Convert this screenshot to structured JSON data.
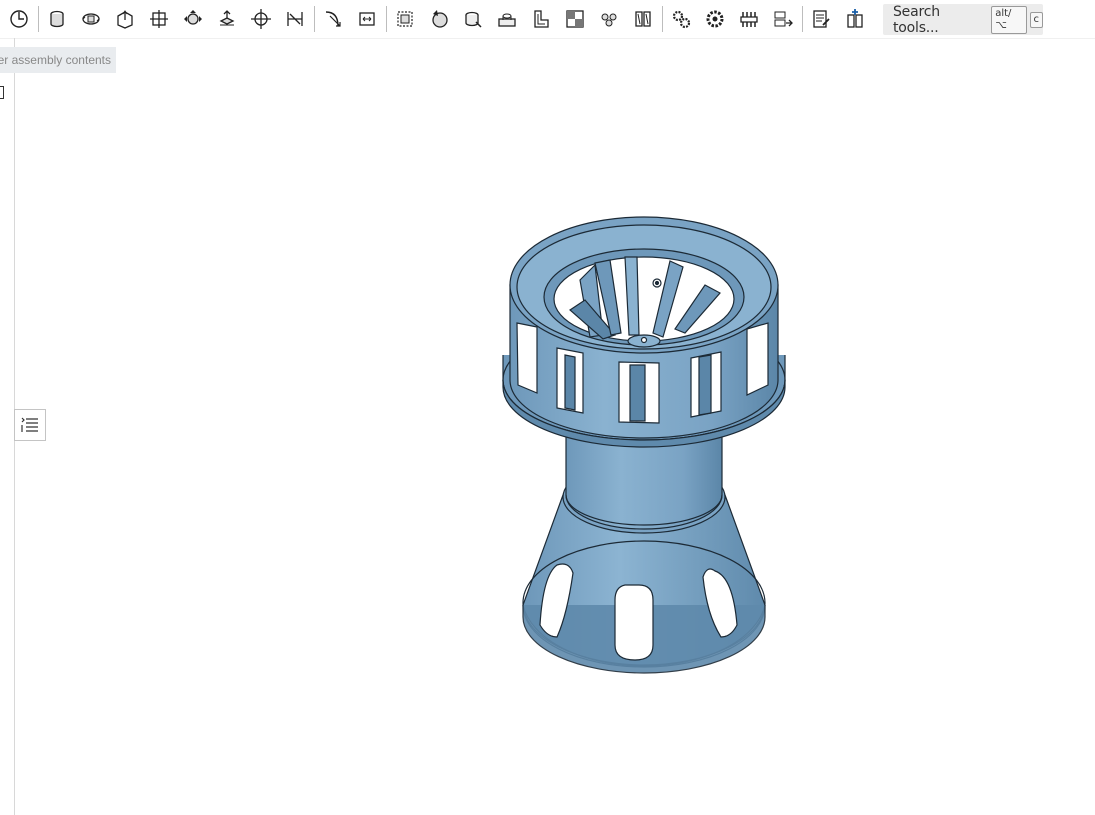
{
  "toolbar": {
    "tools": [
      {
        "name": "history-icon"
      },
      {
        "name": "extrude-icon"
      },
      {
        "name": "revolve-icon"
      },
      {
        "name": "sweep-icon"
      },
      {
        "name": "loft-icon"
      },
      {
        "name": "thicken-icon"
      },
      {
        "name": "enclose-icon"
      },
      {
        "name": "transform-icon"
      },
      {
        "name": "mirror-icon"
      },
      {
        "name": "fillet-icon"
      },
      {
        "name": "chamfer-icon"
      },
      {
        "name": "draft-icon"
      },
      {
        "name": "shell-icon"
      },
      {
        "name": "rib-icon"
      },
      {
        "name": "hole-icon"
      },
      {
        "name": "boolean-icon"
      },
      {
        "name": "split-icon"
      },
      {
        "name": "pattern-icon"
      },
      {
        "name": "sheet-metal-icon"
      },
      {
        "name": "gear-icon"
      },
      {
        "name": "spur-gear-icon"
      },
      {
        "name": "rack-icon"
      },
      {
        "name": "replicate-icon"
      },
      {
        "name": "drawing-icon"
      },
      {
        "name": "configure-icon"
      }
    ]
  },
  "search": {
    "label": "Search tools...",
    "shortcut_mod": "alt/⌥",
    "shortcut_key": "c"
  },
  "assembly_tip": {
    "text": "er assembly contents"
  },
  "model": {
    "color": "#7aa3c4",
    "shade": "#5b86a8",
    "edge": "#1c2a36"
  }
}
